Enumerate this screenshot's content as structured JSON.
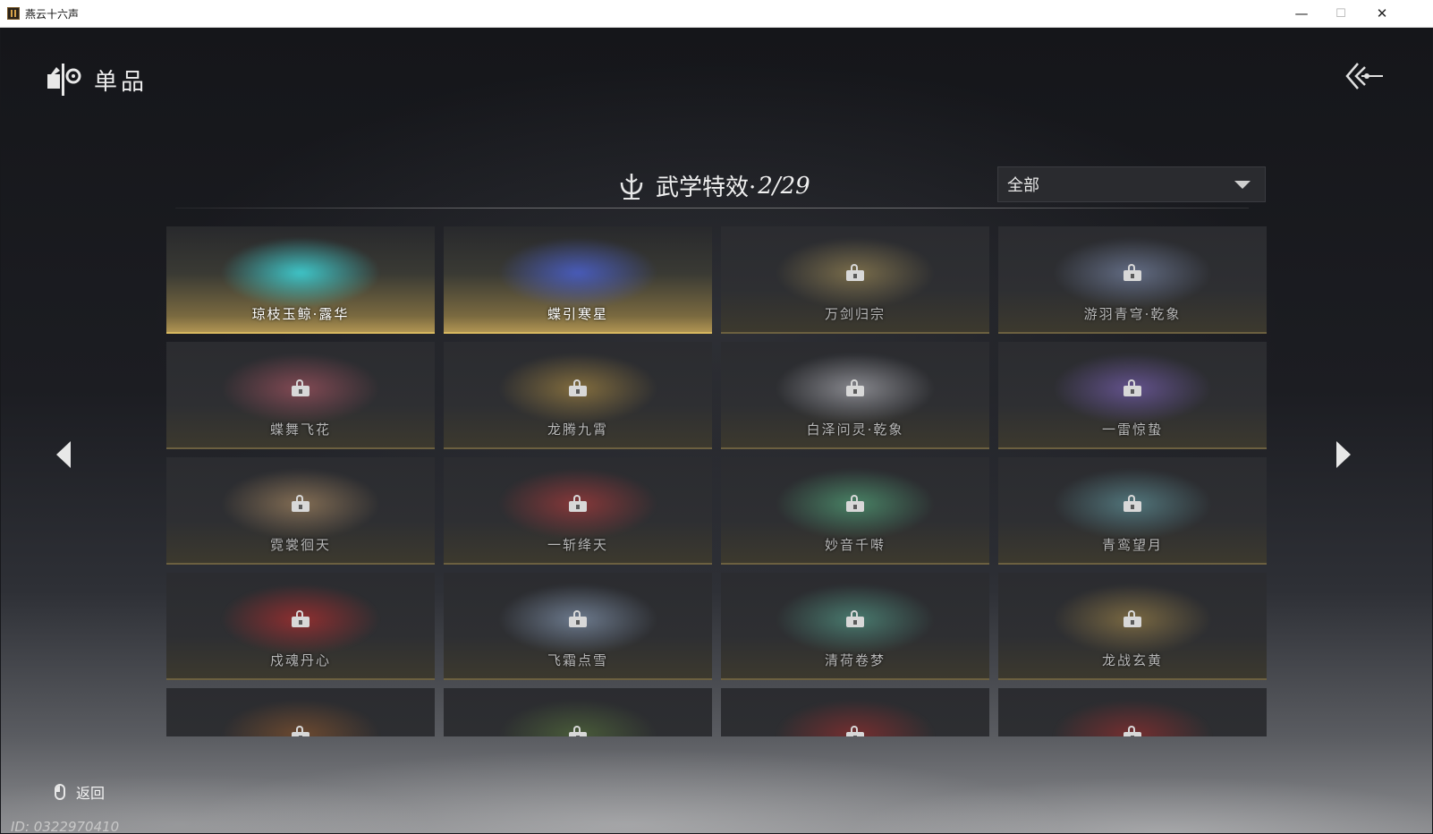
{
  "window": {
    "title": "燕云十六声",
    "minimize": "—",
    "maximize": "☐",
    "close": "✕"
  },
  "header": {
    "title": "单品"
  },
  "section": {
    "title": "武学特效·",
    "count": "2/29"
  },
  "filter": {
    "selected": "全部"
  },
  "cards": [
    {
      "name": "琼枝玉鲸·露华",
      "locked": false,
      "art_color": "#3fd4d8"
    },
    {
      "name": "蝶引寒星",
      "locked": false,
      "art_color": "#4a5fc8"
    },
    {
      "name": "万剑归宗",
      "locked": true,
      "art_color": "#b8a060"
    },
    {
      "name": "游羽青穹·乾象",
      "locked": true,
      "art_color": "#8fa0c8"
    },
    {
      "name": "蝶舞飞花",
      "locked": true,
      "art_color": "#c86070"
    },
    {
      "name": "龙腾九霄",
      "locked": true,
      "art_color": "#c8a048"
    },
    {
      "name": "白泽问灵·乾象",
      "locked": true,
      "art_color": "#d0d0d8"
    },
    {
      "name": "一雷惊蛰",
      "locked": true,
      "art_color": "#9070d8"
    },
    {
      "name": "霓裳徊天",
      "locked": true,
      "art_color": "#c8a070"
    },
    {
      "name": "一斩绛天",
      "locked": true,
      "art_color": "#d04040"
    },
    {
      "name": "妙音千啭",
      "locked": true,
      "art_color": "#60c890"
    },
    {
      "name": "青鸾望月",
      "locked": true,
      "art_color": "#70b0b8"
    },
    {
      "name": "戍魂丹心",
      "locked": true,
      "art_color": "#e03030"
    },
    {
      "name": "飞霜点雪",
      "locked": true,
      "art_color": "#a0b8d8"
    },
    {
      "name": "清荷卷梦",
      "locked": true,
      "art_color": "#60b8a0"
    },
    {
      "name": "龙战玄黄",
      "locked": true,
      "art_color": "#b89850"
    },
    {
      "name": "",
      "locked": true,
      "art_color": "#a06030"
    },
    {
      "name": "",
      "locked": true,
      "art_color": "#608040"
    },
    {
      "name": "",
      "locked": true,
      "art_color": "#b03030"
    },
    {
      "name": "",
      "locked": true,
      "art_color": "#b03030"
    }
  ],
  "footer": {
    "back_label": "返回",
    "player_id": "ID: 0322970410"
  },
  "colors": {
    "accent_gold": "#d8b860",
    "text": "#ececec"
  }
}
